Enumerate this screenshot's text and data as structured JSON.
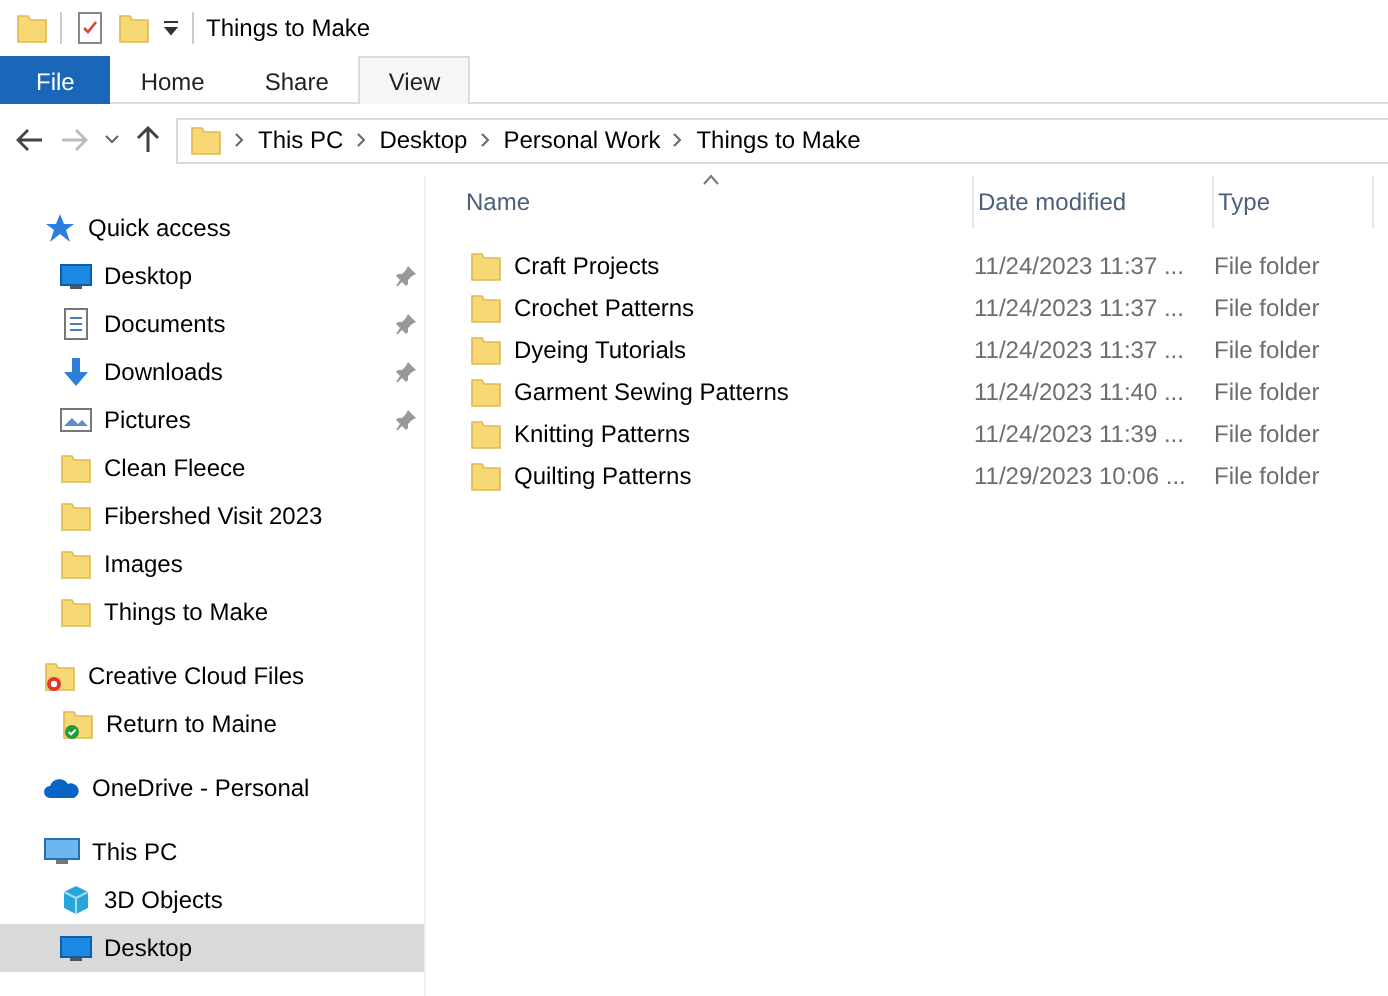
{
  "window": {
    "title": "Things to Make"
  },
  "ribbon_tabs": [
    {
      "label": "File",
      "kind": "file",
      "selected": false
    },
    {
      "label": "Home",
      "kind": "tab",
      "selected": false
    },
    {
      "label": "Share",
      "kind": "tab",
      "selected": false
    },
    {
      "label": "View",
      "kind": "tab",
      "selected": true
    }
  ],
  "address_bar": {
    "path": [
      "This PC",
      "Desktop",
      "Personal Work",
      "Things to Make"
    ]
  },
  "sidebar": {
    "sections": [
      {
        "label": "Quick access",
        "kind": "star",
        "selected": false,
        "children": [
          {
            "label": "Desktop",
            "kind": "desktop",
            "pinned": true,
            "selected": false
          },
          {
            "label": "Documents",
            "kind": "documents",
            "pinned": true,
            "selected": false
          },
          {
            "label": "Downloads",
            "kind": "downloads",
            "pinned": true,
            "selected": false
          },
          {
            "label": "Pictures",
            "kind": "pictures",
            "pinned": true,
            "selected": false
          },
          {
            "label": "Clean Fleece",
            "kind": "folder",
            "pinned": false,
            "selected": false
          },
          {
            "label": "Fibershed Visit 2023",
            "kind": "folder",
            "pinned": false,
            "selected": false
          },
          {
            "label": "Images",
            "kind": "folder",
            "pinned": false,
            "selected": false
          },
          {
            "label": "Things to Make",
            "kind": "folder",
            "pinned": false,
            "selected": false
          }
        ]
      },
      {
        "label": "Creative Cloud Files",
        "kind": "cc-folder",
        "selected": false,
        "children": [
          {
            "label": "Return to Maine",
            "kind": "synced-folder",
            "pinned": false,
            "selected": false
          }
        ]
      },
      {
        "label": "OneDrive - Personal",
        "kind": "cloud",
        "selected": false
      },
      {
        "label": "This PC",
        "kind": "pc",
        "selected": false,
        "children": [
          {
            "label": "3D Objects",
            "kind": "cube",
            "pinned": false,
            "selected": false
          },
          {
            "label": "Desktop",
            "kind": "desktop",
            "pinned": false,
            "selected": true
          }
        ]
      }
    ]
  },
  "file_list": {
    "columns": [
      "Name",
      "Date modified",
      "Type"
    ],
    "rows": [
      {
        "name": "Craft Projects",
        "date_modified": "11/24/2023 11:37 ...",
        "type": "File folder"
      },
      {
        "name": "Crochet Patterns",
        "date_modified": "11/24/2023 11:37 ...",
        "type": "File folder"
      },
      {
        "name": "Dyeing Tutorials",
        "date_modified": "11/24/2023 11:37 ...",
        "type": "File folder"
      },
      {
        "name": "Garment Sewing Patterns",
        "date_modified": "11/24/2023 11:40 ...",
        "type": "File folder"
      },
      {
        "name": "Knitting Patterns",
        "date_modified": "11/24/2023 11:39 ...",
        "type": "File folder"
      },
      {
        "name": "Quilting Patterns",
        "date_modified": "11/29/2023 10:06 ...",
        "type": "File folder"
      }
    ]
  }
}
